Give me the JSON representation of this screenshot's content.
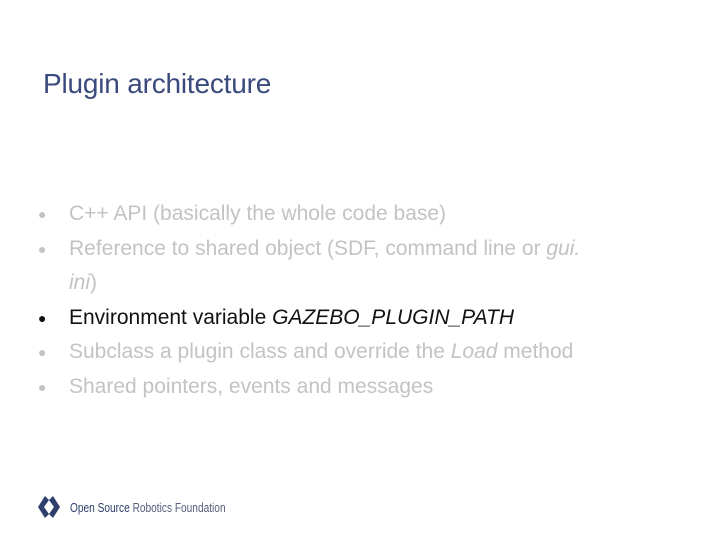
{
  "slide": {
    "title": "Plugin architecture"
  },
  "bullets": [
    {
      "text": "C++ API (basically the whole code base)"
    },
    {
      "text_before": "Reference to shared object (SDF, command line or ",
      "em": "gui.",
      "em2": "ini",
      "text_after": ")"
    },
    {
      "text_before": "Environment variable ",
      "em": "GAZEBO_PLUGIN_PATH"
    },
    {
      "text_before": "Subclass a plugin class and override the ",
      "em": "Load",
      "text_after": " method"
    },
    {
      "text": "Shared pointers, events and messages"
    }
  ],
  "bullet_symbol": "●",
  "footer": {
    "logo_icon": "osrf-logo-icon",
    "logo_text_part1": "Open Source ",
    "logo_text_part2": "Robotics Foundation"
  },
  "colors": {
    "title": "#3b4a7c",
    "bullet_dimmed": "#c3c3c3",
    "bullet_active": "#111111",
    "logo": "#2f3f6c"
  }
}
